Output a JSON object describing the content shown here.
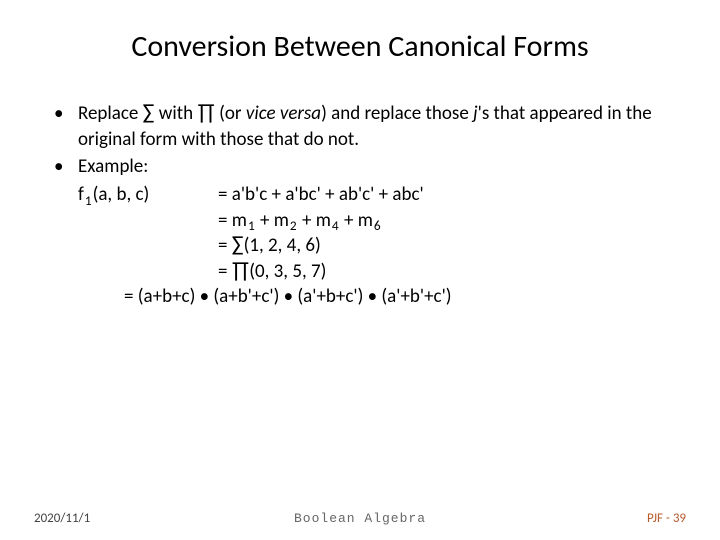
{
  "title": "Conversion Between Canonical Forms",
  "bullets": {
    "b1_pre": "Replace ",
    "b1_sum": "∑",
    "b1_mid1": " with ",
    "b1_prod": "∏",
    "b1_mid2": " (or ",
    "b1_vice": "vice versa",
    "b1_mid3": ") and replace those ",
    "b1_j": "j",
    "b1_tail": "'s that appeared in the original form with those that do not.",
    "b2": "Example:"
  },
  "func": {
    "name": "f",
    "sub": "1",
    "args": "(a, b, c)"
  },
  "eq": {
    "l1": "= a'b'c + a'bc' + ab'c' + abc'",
    "l2a": "= m",
    "l2s1": "1",
    "l2b": " + m",
    "l2s2": "2",
    "l2c": " + m",
    "l2s3": "4",
    "l2d": " + m",
    "l2s4": "6",
    "l3a": "= ",
    "l3sum": "∑",
    "l3b": "(1, 2, 4, 6)",
    "l4a": "= ",
    "l4prod": "∏",
    "l4b": "(0, 3, 5, 7)",
    "l5": "= (a+b+c) • (a+b'+c') • (a'+b+c') • (a'+b'+c')"
  },
  "footer": {
    "date": "2020/11/1",
    "center": "Boolean Algebra",
    "right": "PJF - 39"
  }
}
